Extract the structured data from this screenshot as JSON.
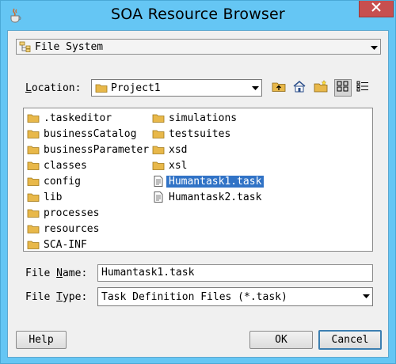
{
  "window": {
    "title": "SOA Resource Browser"
  },
  "source_dropdown": {
    "selected": "File System"
  },
  "location": {
    "label_prefix": "",
    "label_accel": "L",
    "label_rest": "ocation:",
    "selected": "Project1"
  },
  "toolbar": {
    "buttons": [
      "up-folder",
      "home",
      "new-folder",
      "list-view",
      "details-view"
    ]
  },
  "files": {
    "column1": [
      {
        "name": ".taskeditor",
        "type": "folder"
      },
      {
        "name": "businessCatalog",
        "type": "folder"
      },
      {
        "name": "businessParameter",
        "type": "folder"
      },
      {
        "name": "classes",
        "type": "folder"
      },
      {
        "name": "config",
        "type": "folder"
      },
      {
        "name": "lib",
        "type": "folder"
      },
      {
        "name": "processes",
        "type": "folder"
      },
      {
        "name": "resources",
        "type": "folder"
      },
      {
        "name": "SCA-INF",
        "type": "folder"
      }
    ],
    "column2": [
      {
        "name": "simulations",
        "type": "folder"
      },
      {
        "name": "testsuites",
        "type": "folder"
      },
      {
        "name": "xsd",
        "type": "folder"
      },
      {
        "name": "xsl",
        "type": "folder"
      },
      {
        "name": "Humantask1.task",
        "type": "file",
        "selected": true
      },
      {
        "name": "Humantask2.task",
        "type": "file"
      }
    ]
  },
  "file_name": {
    "label_prefix": "File ",
    "label_accel": "N",
    "label_rest": "ame:",
    "value": "Humantask1.task"
  },
  "file_type": {
    "label_prefix": "File ",
    "label_accel": "T",
    "label_rest": "ype:",
    "selected": "Task Definition Files (*.task)"
  },
  "buttons": {
    "help": "Help",
    "ok": "OK",
    "cancel": "Cancel"
  },
  "colors": {
    "title_bar": "#65c6f4",
    "close_button": "#c74f4f",
    "selection": "#3173c6",
    "folder": "#e8b84a"
  }
}
